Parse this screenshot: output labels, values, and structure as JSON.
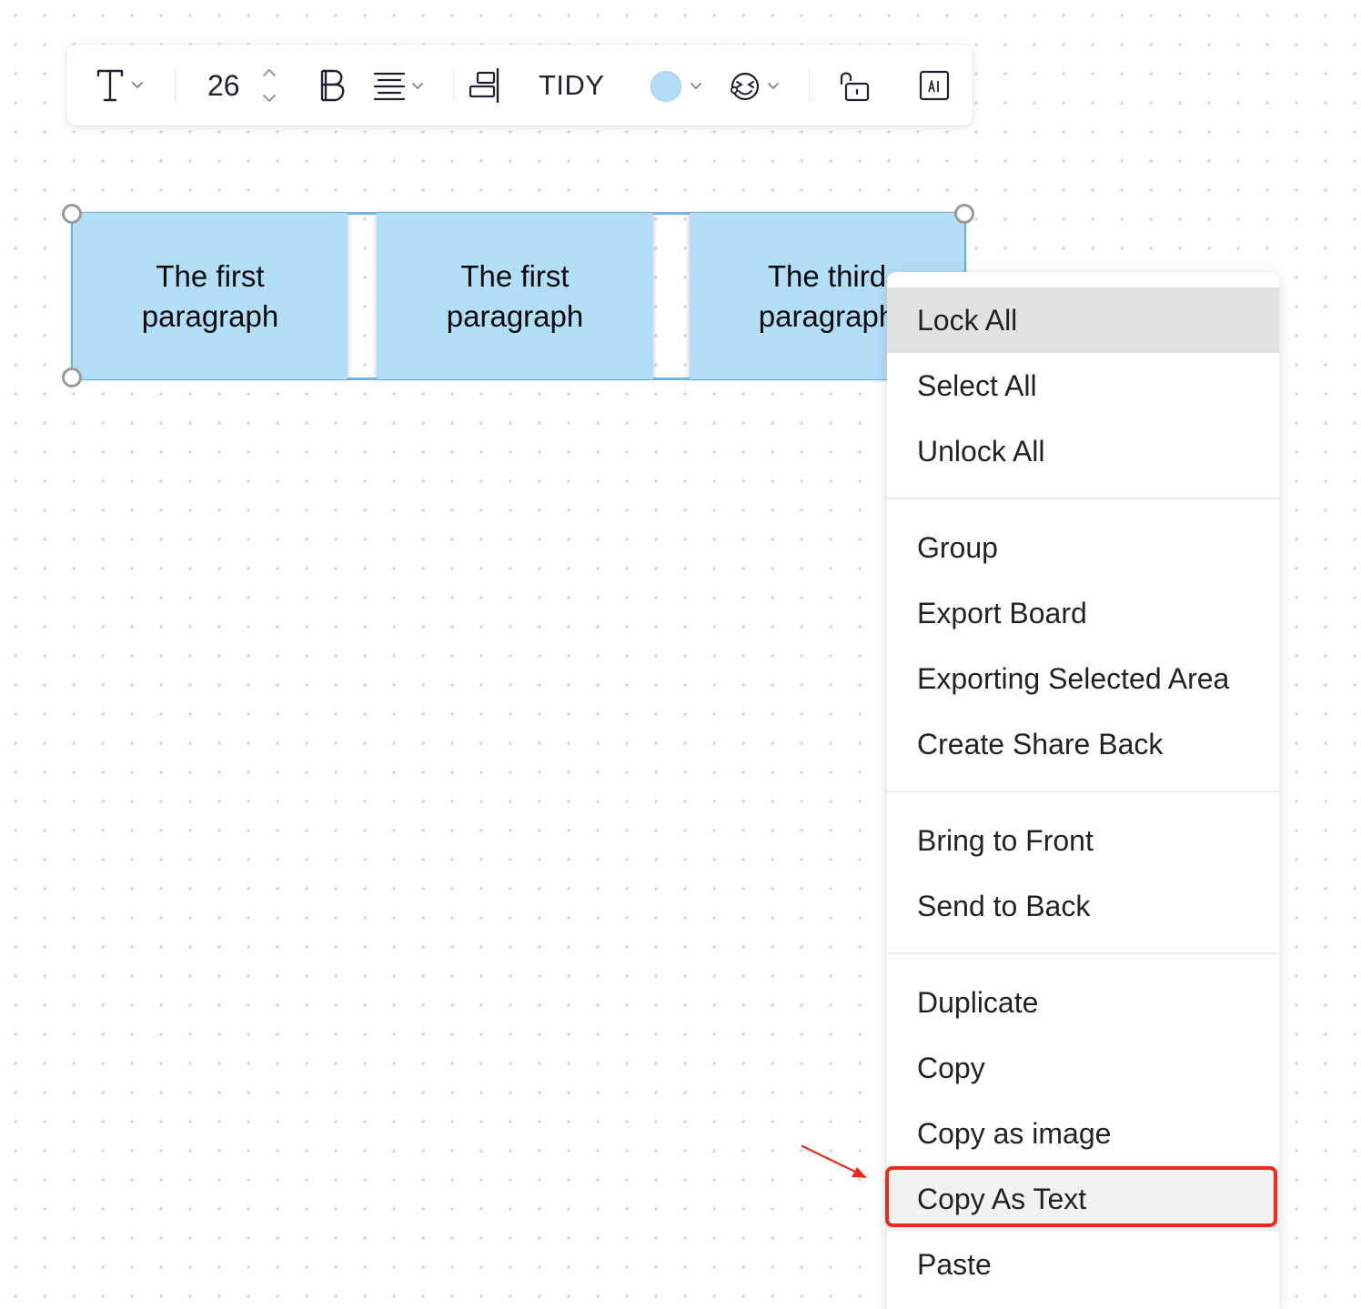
{
  "toolbar": {
    "font_size": "26",
    "tidy_label": "TIDY",
    "icons": {
      "text_style": "text-t-icon",
      "bold": "bold-icon",
      "align": "align-center-icon",
      "layout": "align-right-icon",
      "fill_color": "color-swatch",
      "emoji": "emoji-icon",
      "lock": "unlock-icon",
      "ai": "ai-icon"
    },
    "fill_color": "#b3def7"
  },
  "canvas": {
    "cards": [
      {
        "text": "The first\nparagraph"
      },
      {
        "text": "The first\nparagraph"
      },
      {
        "text": "The third\nparagraph"
      }
    ],
    "selection_color": "#6eb6ea"
  },
  "context_menu": {
    "items": [
      {
        "label": "Lock All"
      },
      {
        "label": "Select All"
      },
      {
        "label": "Unlock All"
      },
      {
        "label": "Group"
      },
      {
        "label": "Export Board"
      },
      {
        "label": "Exporting Selected Area"
      },
      {
        "label": "Create Share Back"
      },
      {
        "label": "Bring to Front"
      },
      {
        "label": "Send to Back"
      },
      {
        "label": "Duplicate"
      },
      {
        "label": "Copy"
      },
      {
        "label": "Copy as image"
      },
      {
        "label": "Copy As Text"
      },
      {
        "label": "Paste"
      }
    ],
    "highlight_color": "#ef2a1c"
  }
}
